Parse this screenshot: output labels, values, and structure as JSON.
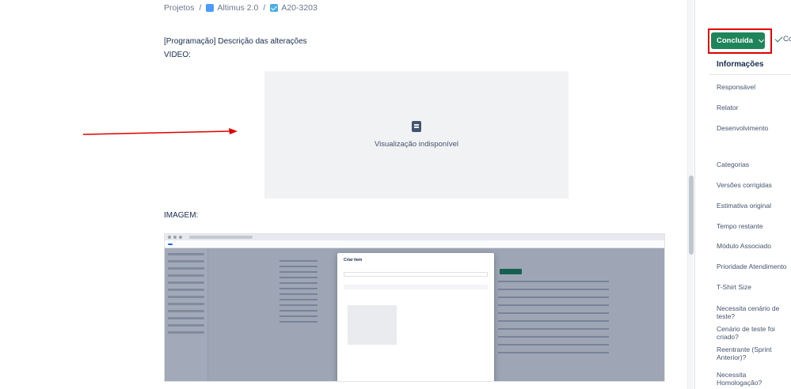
{
  "breadcrumb": {
    "root": "Projetos",
    "separator": "/",
    "project": "Altimus 2.0",
    "issue": "A20-3203"
  },
  "content": {
    "section_title": "[Programação] Descrição das alterações",
    "video_label": "VIDEO:",
    "preview_unavailable": "Visualização indisponível",
    "image_label": "IMAGEM:"
  },
  "embedded_screenshot": {
    "modal_title": "Criar item"
  },
  "sidebar": {
    "status_label": "Concluída",
    "done_label": "Co",
    "info_header": "Informações",
    "fields": [
      "Responsável",
      "Relator",
      "Desenvolvimento",
      "Categorias",
      "Versões corrigidas",
      "Estimativa original",
      "Tempo restante",
      "Módulo Associado",
      "Prioridade Atendimento",
      "T-Shirt Size",
      "Necessita cenário de teste?",
      "Cenário de teste foi criado?",
      "Reentrante (Sprint Anterior)?",
      "Necessita Homologação?"
    ]
  },
  "colors": {
    "status_green": "#1f845a",
    "highlight_red": "#e00000",
    "arrow_red": "#e00000"
  }
}
